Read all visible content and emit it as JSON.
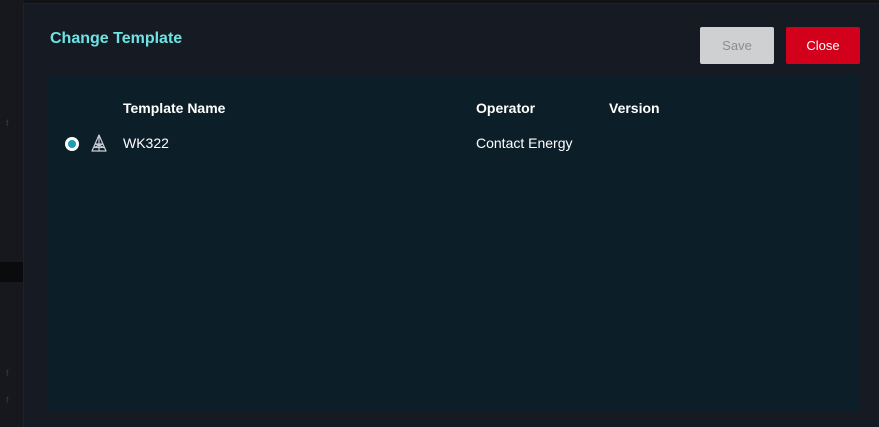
{
  "dialog": {
    "title": "Change Template",
    "save_label": "Save",
    "close_label": "Close"
  },
  "table": {
    "columns": [
      "Template Name",
      "Operator",
      "Version"
    ],
    "rows": [
      {
        "selected": true,
        "icon": "tower-icon",
        "name": "WK322",
        "operator": "Contact Energy",
        "version": ""
      }
    ]
  },
  "colors": {
    "title": "#6ee3e3",
    "close_button": "#d3001b",
    "save_button_disabled": "#cfd0d2",
    "panel": "#0c1e27",
    "radio_selected": "#1f9bb3"
  }
}
